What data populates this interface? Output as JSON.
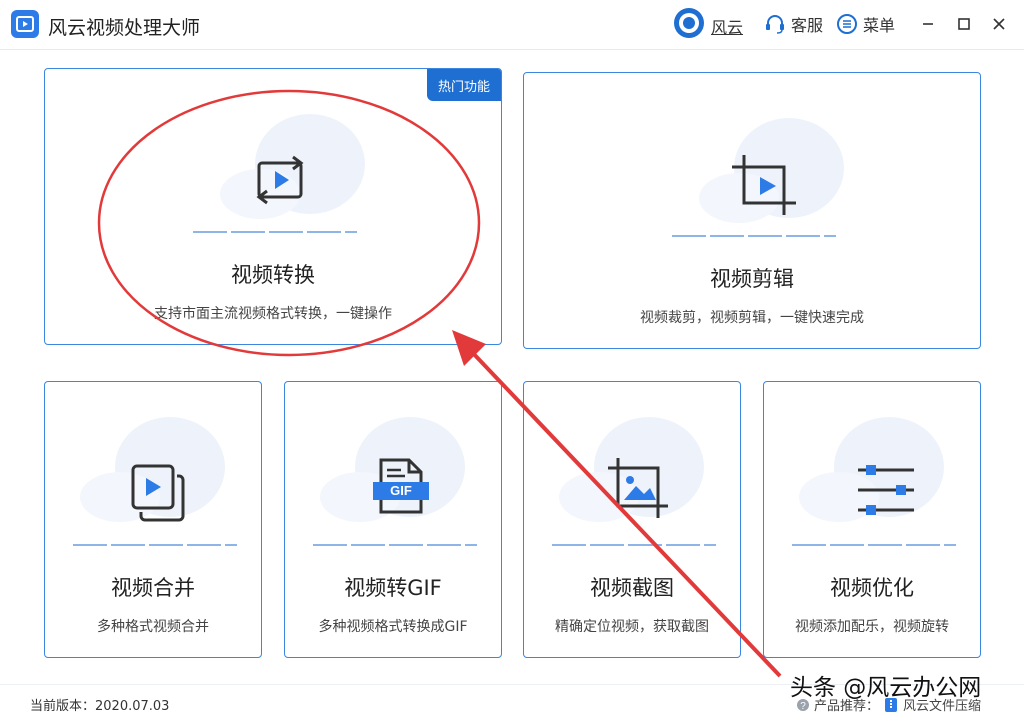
{
  "app": {
    "title": "风云视频处理大师"
  },
  "header": {
    "brand_label": "风云",
    "service_label": "客服",
    "menu_label": "菜单"
  },
  "cards": [
    {
      "title": "视频转换",
      "desc": "支持市面主流视频格式转换，一键操作",
      "badge": "热门功能",
      "icon": "convert-video-icon"
    },
    {
      "title": "视频剪辑",
      "desc": "视频裁剪，视频剪辑，一键快速完成",
      "icon": "crop-video-icon"
    },
    {
      "title": "视频合并",
      "desc": "多种格式视频合并",
      "icon": "merge-video-icon"
    },
    {
      "title": "视频转GIF",
      "desc": "多种视频格式转换成GIF",
      "icon": "gif-file-icon",
      "icon_text": "GIF"
    },
    {
      "title": "视频截图",
      "desc": "精确定位视频，获取截图",
      "icon": "screenshot-icon"
    },
    {
      "title": "视频优化",
      "desc": "视频添加配乐，视频旋转",
      "icon": "sliders-icon"
    }
  ],
  "footer": {
    "version_label": "当前版本：2020.07.03",
    "recommend_label": "产品推荐：",
    "recommend_product": "风云文件压缩"
  },
  "watermark": "头条 @风云办公网",
  "colors": {
    "accent": "#1e6fd1",
    "border": "#3b87e0",
    "annotation": "#e23a3a"
  }
}
